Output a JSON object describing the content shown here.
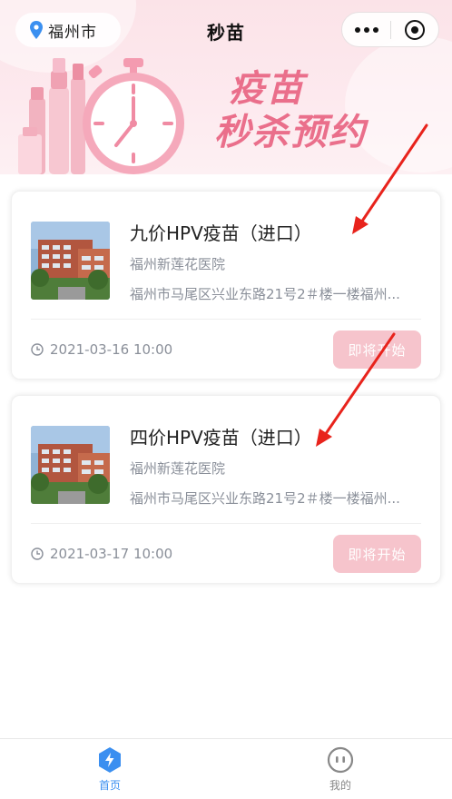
{
  "header": {
    "city": "福州市",
    "title": "秒苗"
  },
  "banner": {
    "line1": "疫苗",
    "line2": "秒杀预约"
  },
  "cards": [
    {
      "name": "九价HPV疫苗（进口）",
      "hospital": "福州新莲花医院",
      "address": "福州市马尾区兴业东路21号2＃楼一楼福州...",
      "time": "2021-03-16 10:00",
      "button": "即将开始"
    },
    {
      "name": "四价HPV疫苗（进口）",
      "hospital": "福州新莲花医院",
      "address": "福州市马尾区兴业东路21号2＃楼一楼福州...",
      "time": "2021-03-17 10:00",
      "button": "即将开始"
    }
  ],
  "tabbar": {
    "home": "首页",
    "mine": "我的"
  },
  "colors": {
    "accent": "#3b8ff0",
    "banner_text": "#ea6f8b",
    "button_disabled": "#f6c4cc",
    "annotation_arrow": "#e8231c"
  }
}
